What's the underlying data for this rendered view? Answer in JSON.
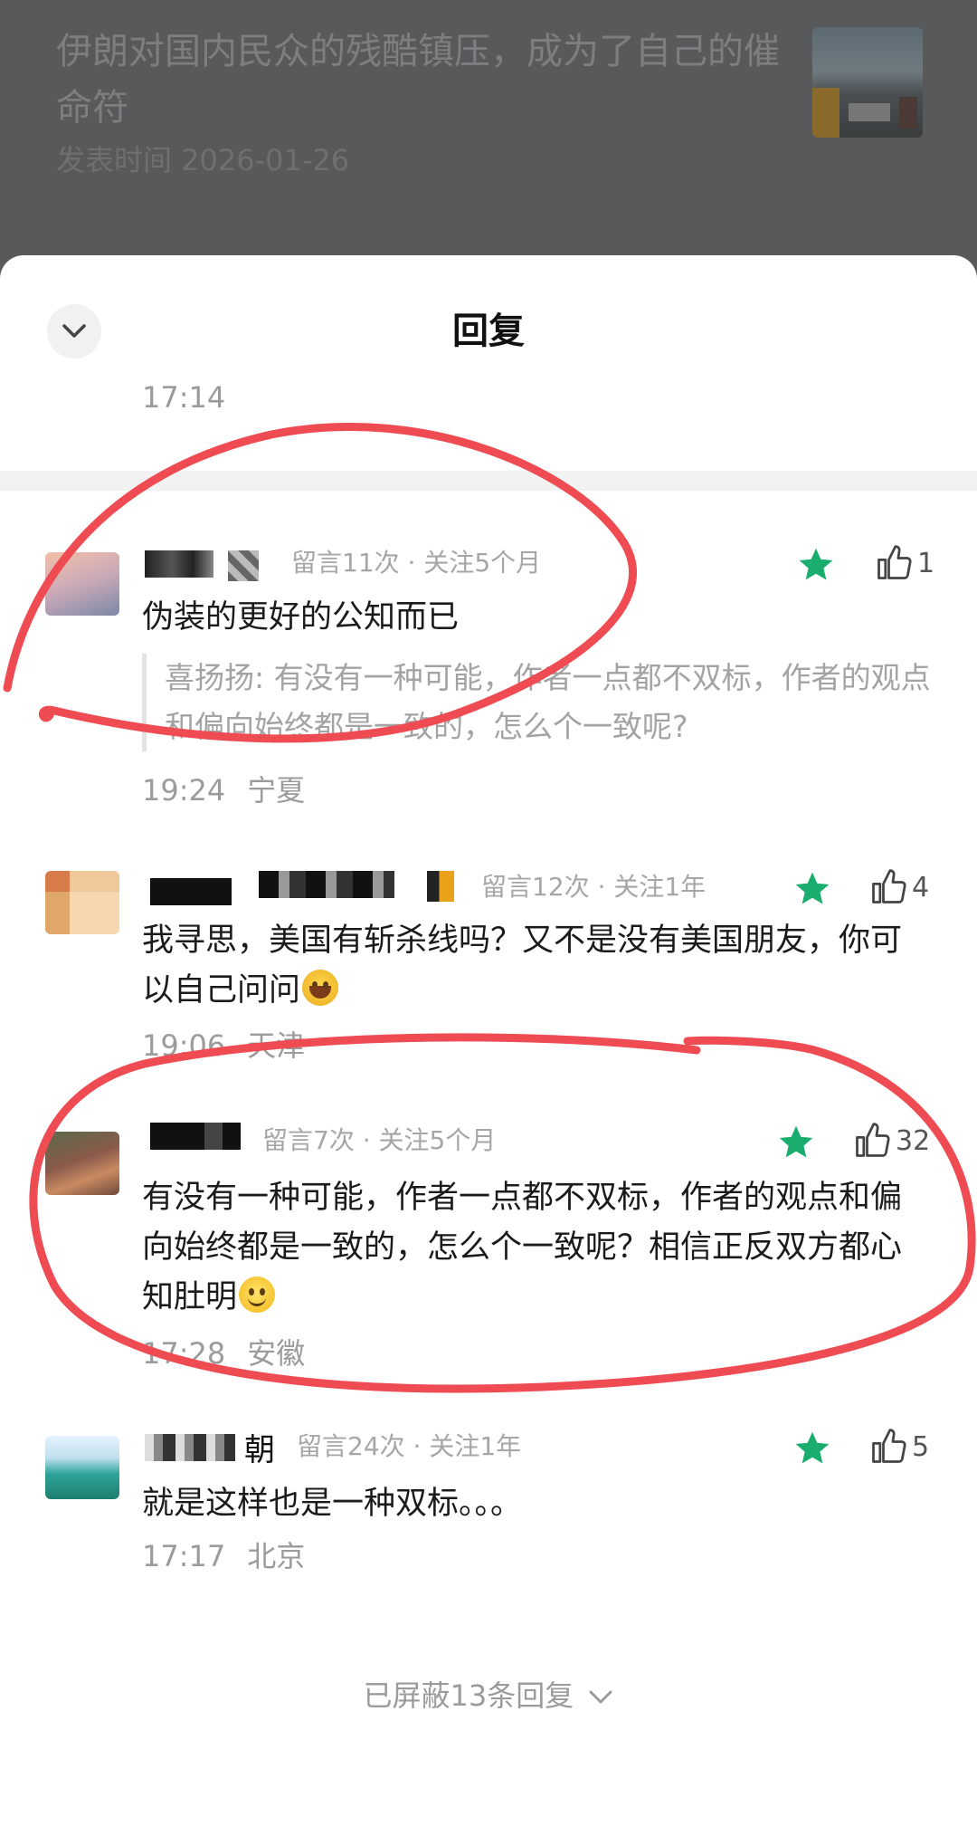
{
  "article": {
    "title": "伊朗对国内民众的残酷镇压，成为了自己的催命符",
    "date": "发表时间 2026-01-26"
  },
  "sheet": {
    "title": "回复",
    "prev_time": "17:14"
  },
  "comments": [
    {
      "meta": "留言11次 · 关注5个月",
      "likes": "1",
      "body": "伪装的更好的公知而已",
      "quote": "喜扬扬: 有没有一种可能，作者一点都不双标，作者的观点和偏向始终都是一致的，怎么个一致呢?",
      "time": "19:24",
      "location": "宁夏"
    },
    {
      "meta": "留言12次 · 关注1年",
      "likes": "4",
      "body": "我寻思，美国有斩杀线吗？又不是没有美国朋友，你可以自己问问",
      "time": "19:06",
      "location": "天津"
    },
    {
      "meta": "留言7次 · 关注5个月",
      "likes": "32",
      "body": "有没有一种可能，作者一点都不双标，作者的观点和偏向始终都是一致的，怎么个一致呢？相信正反双方都心知肚明",
      "time": "17:28",
      "location": "安徽"
    },
    {
      "name_visible": "朝",
      "meta": "留言24次 · 关注1年",
      "likes": "5",
      "body": "就是这样也是一种双标。。。",
      "time": "17:17",
      "location": "北京"
    }
  ],
  "footer": {
    "hidden_replies": "已屏蔽13条回复"
  },
  "colors": {
    "accent_green": "#1aad6e",
    "annotation_red": "#ee4b52",
    "overlay_gray": "#58595b"
  },
  "icons": [
    "chevron-down-icon",
    "star-icon",
    "thumb-up-icon",
    "emoji-cry-laugh",
    "emoji-smile"
  ]
}
